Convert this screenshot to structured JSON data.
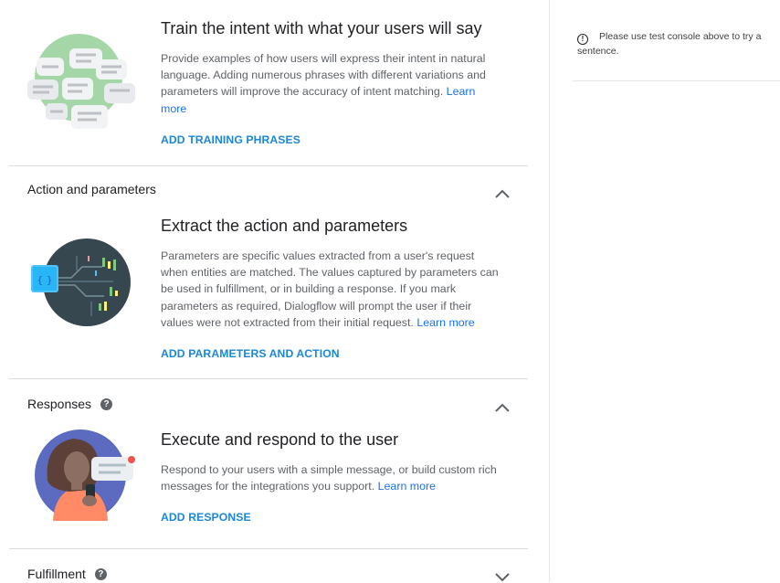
{
  "training": {
    "title": "Train the intent with what your users will say",
    "description": "Provide examples of how users will express their intent in natural language. Adding numerous phrases with different variations and parameters will improve the accuracy of intent matching.",
    "learn_more": "Learn more",
    "action": "ADD TRAINING PHRASES"
  },
  "action_parameters": {
    "heading": "Action and parameters",
    "title": "Extract the action and parameters",
    "description": "Parameters are specific values extracted from a user's request when entities are matched. The values captured by parameters can be used in fulfillment, or in building a response. If you mark parameters as required, Dialogflow will prompt the user if their values were not extracted from their initial request.",
    "learn_more": "Learn more",
    "action": "ADD PARAMETERS AND ACTION"
  },
  "responses": {
    "heading": "Responses",
    "title": "Execute and respond to the user",
    "description": "Respond to your users with a simple message, or build custom rich messages for the integrations you support.",
    "learn_more": "Learn more",
    "action": "ADD RESPONSE"
  },
  "fulfillment": {
    "heading": "Fulfillment"
  },
  "side_panel": {
    "notice": "Please use test console above to try a sentence."
  },
  "icons": {
    "help": "help-circle-icon",
    "info": "info-icon",
    "expanded": "chevron-up-icon",
    "collapsed": "chevron-down-icon"
  },
  "colors": {
    "link": "#1a73e8",
    "action": "#1a88d8",
    "divider": "#dadce0"
  }
}
